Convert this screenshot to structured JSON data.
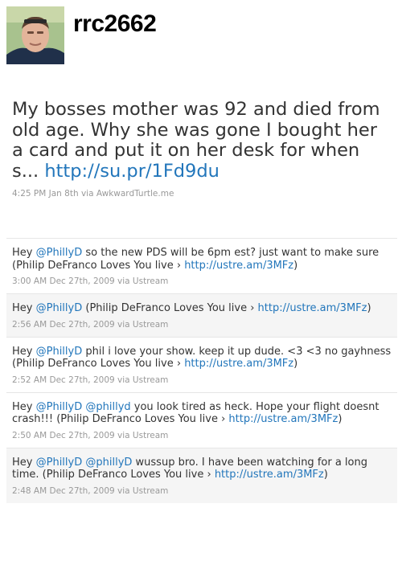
{
  "profile": {
    "username": "rrc2662",
    "avatar_icon": "profile-photo"
  },
  "featured_tweet": {
    "text": "My bosses mother was 92 and died from old age. Why she was gone I bought her a card and put it on her desk for when s...",
    "link": "http://su.pr/1Fd9du",
    "meta": "4:25 PM Jan 8th via AwkwardTurtle.me"
  },
  "tweets": [
    {
      "prefix": "Hey ",
      "mention": "@PhillyD",
      "mention2": "",
      "body": " so the new PDS will be 6pm est? just want to make sure (Philip DeFranco Loves You live › ",
      "link": "http://ustre.am/3MFz",
      "suffix": ")",
      "meta": "3:00 AM Dec 27th, 2009 via Ustream"
    },
    {
      "prefix": "Hey ",
      "mention": "@PhillyD",
      "mention2": "",
      "body": " (Philip DeFranco Loves You live › ",
      "link": "http://ustre.am/3MFz",
      "suffix": ")",
      "meta": "2:56 AM Dec 27th, 2009 via Ustream"
    },
    {
      "prefix": "Hey ",
      "mention": "@PhillyD",
      "mention2": "",
      "body": " phil i love your show. keep it up dude. <3 <3 no gayhness (Philip DeFranco Loves You live › ",
      "link": "http://ustre.am/3MFz",
      "suffix": ")",
      "meta": "2:52 AM Dec 27th, 2009 via Ustream"
    },
    {
      "prefix": "Hey ",
      "mention": "@PhillyD",
      "mention2": "@phillyd",
      "body": " you look tired as heck. Hope your flight doesnt crash!!! (Philip DeFranco Loves You live › ",
      "link": "http://ustre.am/3MFz",
      "suffix": ")",
      "meta": "2:50 AM Dec 27th, 2009 via Ustream"
    },
    {
      "prefix": "Hey ",
      "mention": "@PhillyD",
      "mention2": "@phillyD",
      "body": " wussup bro. I have been watching for a long time. (Philip DeFranco Loves You live › ",
      "link": "http://ustre.am/3MFz",
      "suffix": ")",
      "meta": "2:48 AM Dec 27th, 2009 via Ustream"
    }
  ],
  "colors": {
    "link": "#2276bb",
    "meta": "#999999",
    "alt_row": "#f5f5f5"
  }
}
